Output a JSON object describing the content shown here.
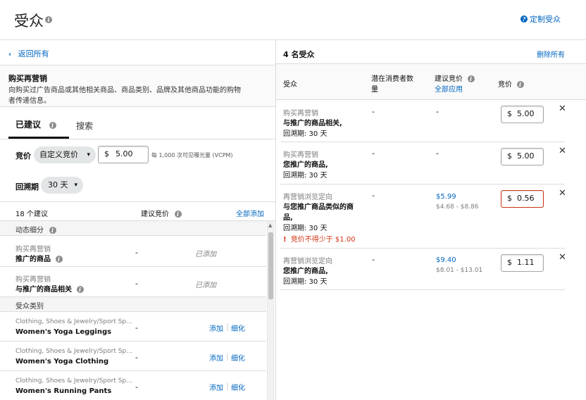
{
  "header": {
    "title": "受众",
    "customize_label": "定制受众"
  },
  "left": {
    "back_label": "返回所有",
    "section_title": "购买再营销",
    "section_desc_line1": "向购买过广告商品或其他相关商品、商品类别、品牌及其他商品功能的购物",
    "section_desc_line2": "者传递信息。",
    "tabs": [
      {
        "label": "已建议"
      },
      {
        "label": "搜索"
      }
    ],
    "bid_label": "竞价",
    "bid_select": "自定义竞价",
    "bid_currency": "$",
    "bid_value": "5.00",
    "bid_note": "每 1,000 次可见曝光量 (VCPM)",
    "lookback_label": "回溯期",
    "lookback_value": "30 天",
    "list_header": {
      "count": "18 个建议",
      "suggested_bid": "建议竞价",
      "add_all": "全部添加"
    },
    "groups": [
      {
        "name": "动态细分",
        "items": [
          {
            "cat": "购买再营销",
            "name": "推广的商品",
            "bid": "-",
            "status": "已添加"
          },
          {
            "cat": "购买再营销",
            "name": "与推广的商品相关",
            "bid": "-",
            "status": "已添加"
          }
        ]
      },
      {
        "name": "受众类别",
        "items": [
          {
            "cat": "Clothing, Shoes & Jewelry/Sport Sp...",
            "name": "Women's Yoga Leggings",
            "bid": "-",
            "add": "添加",
            "refine": "细化"
          },
          {
            "cat": "Clothing, Shoes & Jewelry/Sport Sp...",
            "name": "Women's Yoga Clothing",
            "bid": "-",
            "add": "添加",
            "refine": "细化"
          },
          {
            "cat": "Clothing, Shoes & Jewelry/Sport Sp...",
            "name": "Women's Running Pants",
            "bid": "-",
            "add": "添加",
            "refine": "细化"
          }
        ]
      }
    ]
  },
  "right": {
    "count_title": "4 名受众",
    "remove_all": "删除所有",
    "columns": {
      "audience": "受众",
      "reach_line1": "潜在消费者数",
      "reach_line2": "量",
      "suggested_bid": "建议竞价",
      "apply_all": "全部应用",
      "bid": "竞价"
    },
    "rows": [
      {
        "cat": "购买再营销",
        "line1": "与推广的商品相关,",
        "line2": "回溯期: 30 天",
        "reach": "-",
        "suggested": "-",
        "range": "",
        "currency": "$",
        "bid": "5.00",
        "error": ""
      },
      {
        "cat": "购买再营销",
        "line1": "您推广的商品,",
        "line2": "回溯期: 30 天",
        "reach": "-",
        "suggested": "-",
        "range": "",
        "currency": "$",
        "bid": "5.00",
        "error": ""
      },
      {
        "cat": "再营销浏览定向",
        "line1": "与您推广商品类似的商",
        "line1b": "品,",
        "line2": "回溯期: 30 天",
        "reach": "-",
        "suggested": "$5.99",
        "range": "$4.68 - $8.86",
        "currency": "$",
        "bid": "0.56",
        "error": "竞价不得少于 $1.00"
      },
      {
        "cat": "再营销浏览定向",
        "line1": "您推广的商品,",
        "line2": "回溯期: 30 天",
        "reach": "-",
        "suggested": "$9.40",
        "range": "$8.01 - $13.01",
        "currency": "$",
        "bid": "1.11",
        "error": ""
      }
    ]
  },
  "colors": {
    "link": "#0066c0",
    "error": "#d13212",
    "border": "#dcdcdc"
  }
}
